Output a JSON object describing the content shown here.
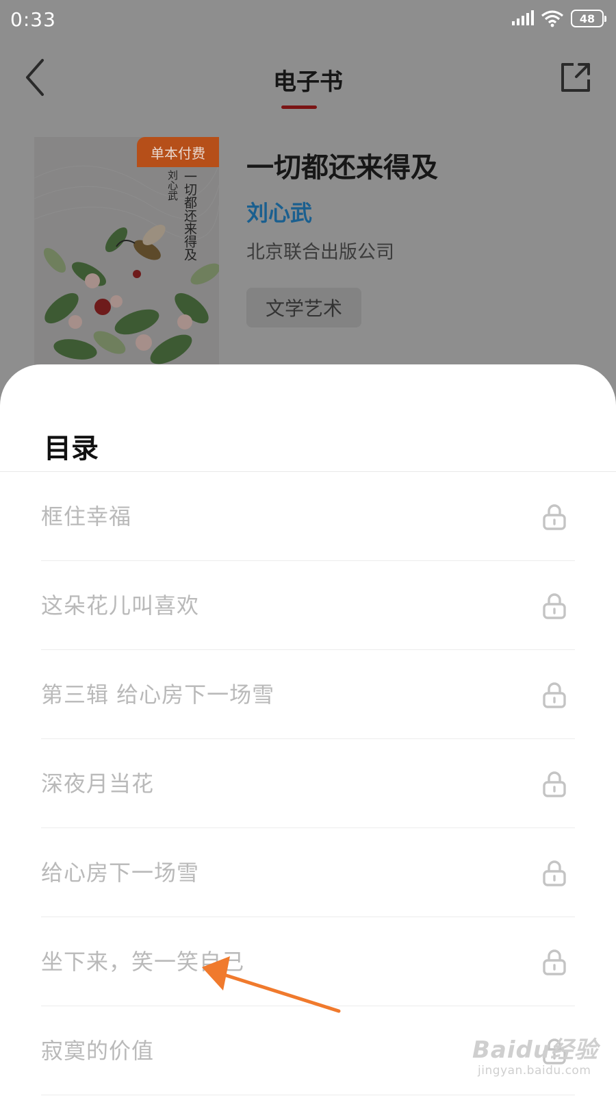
{
  "status_bar": {
    "time": "0:33",
    "battery_level": "48",
    "icons": [
      "signal-icon",
      "wifi-icon",
      "battery-icon"
    ]
  },
  "nav": {
    "title": "电子书",
    "back_icon": "back-chevron-icon",
    "share_icon": "share-icon",
    "accent_color": "#c8282d"
  },
  "book": {
    "cover_badge": "单本付费",
    "cover_title": "一切都还来得及",
    "cover_author": "刘心武",
    "title": "一切都还来得及",
    "author": "刘心武",
    "publisher": "北京联合出版公司",
    "tag": "文学艺术"
  },
  "toc": {
    "title": "目录",
    "items": [
      {
        "label": "框住幸福",
        "locked": true
      },
      {
        "label": "这朵花儿叫喜欢",
        "locked": true
      },
      {
        "label": "第三辑 给心房下一场雪",
        "locked": true
      },
      {
        "label": "深夜月当花",
        "locked": true
      },
      {
        "label": "给心房下一场雪",
        "locked": true
      },
      {
        "label": "坐下来，笑一笑自己",
        "locked": true
      },
      {
        "label": "寂寞的价值",
        "locked": true
      }
    ]
  },
  "watermark": {
    "main": "Baidu经验",
    "sub": "jingyan.baidu.com"
  },
  "colors": {
    "overlay_dim": "#8e8e8e",
    "author_link": "#1a5f8f",
    "annotation_arrow": "#f07a2d",
    "locked_text": "#b9b9b9"
  }
}
